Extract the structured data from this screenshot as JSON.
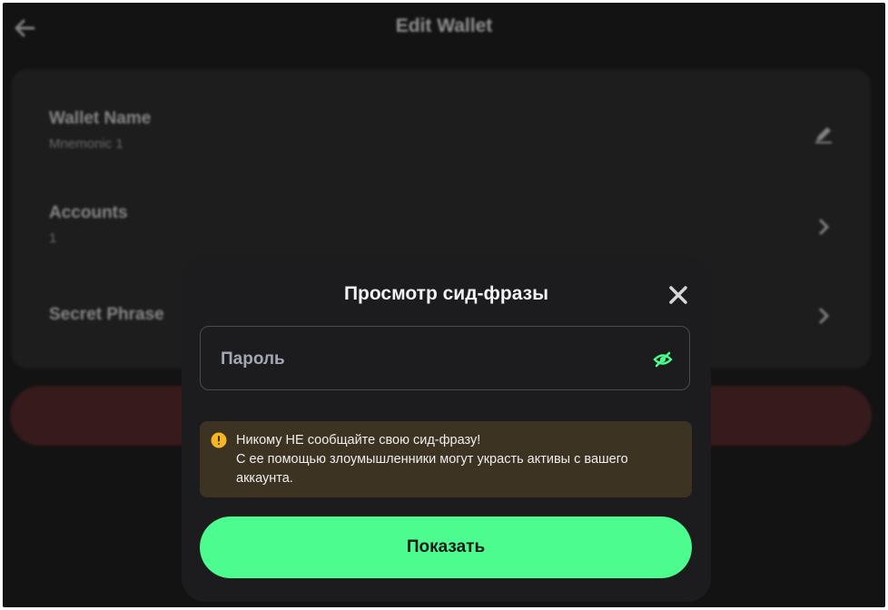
{
  "header": {
    "title": "Edit Wallet",
    "back_icon": "arrow-left-icon"
  },
  "wallet": {
    "rows": [
      {
        "title": "Wallet Name",
        "value": "Mnemonic 1",
        "icon": "edit-icon"
      },
      {
        "title": "Accounts",
        "value": "1",
        "icon": "chevron-right-icon"
      },
      {
        "title": "Secret Phrase",
        "value": "",
        "icon": "chevron-right-icon"
      }
    ]
  },
  "modal": {
    "title": "Просмотр сид-фразы",
    "close_icon": "close-icon",
    "password": {
      "placeholder": "Пароль",
      "value": "",
      "toggle_icon": "eye-off-icon"
    },
    "warning": {
      "icon": "warning-icon",
      "line1": "Никому НЕ сообщайте свою сид-фразу!",
      "line2": "С ее помощью злоумышленники могут украсть активы с вашего аккаунта."
    },
    "show_button_label": "Показать"
  },
  "colors": {
    "accent": "#4cfc8e",
    "modal_bg": "#1c1c1e",
    "warning_bg": "#3d3322",
    "warning_icon": "#f5b623",
    "danger": "#5a2a2d"
  }
}
